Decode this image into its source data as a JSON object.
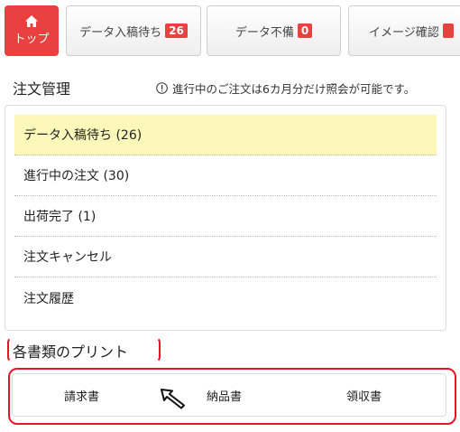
{
  "tabs": {
    "home_label": "トップ",
    "items": [
      {
        "label": "データ入稿待ち",
        "badge": "26"
      },
      {
        "label": "データ不備",
        "badge": "0"
      },
      {
        "label": "イメージ確認",
        "badge": ""
      }
    ]
  },
  "orders": {
    "title": "注文管理",
    "notice": "進行中のご注文は6カ月分だけ照会が可能です。",
    "items": [
      {
        "label": "データ入稿待ち (26)"
      },
      {
        "label": "進行中の注文 (30)"
      },
      {
        "label": "出荷完了 (1)"
      },
      {
        "label": "注文キャンセル"
      },
      {
        "label": "注文履歴"
      }
    ]
  },
  "print": {
    "title": "各書類のプリント",
    "links": [
      {
        "label": "請求書"
      },
      {
        "label": "納品書"
      },
      {
        "label": "領収書"
      }
    ]
  },
  "colors": {
    "accent": "#e8413f",
    "highlight_row": "#fbf8ba",
    "annotation_red": "#e8142a"
  }
}
